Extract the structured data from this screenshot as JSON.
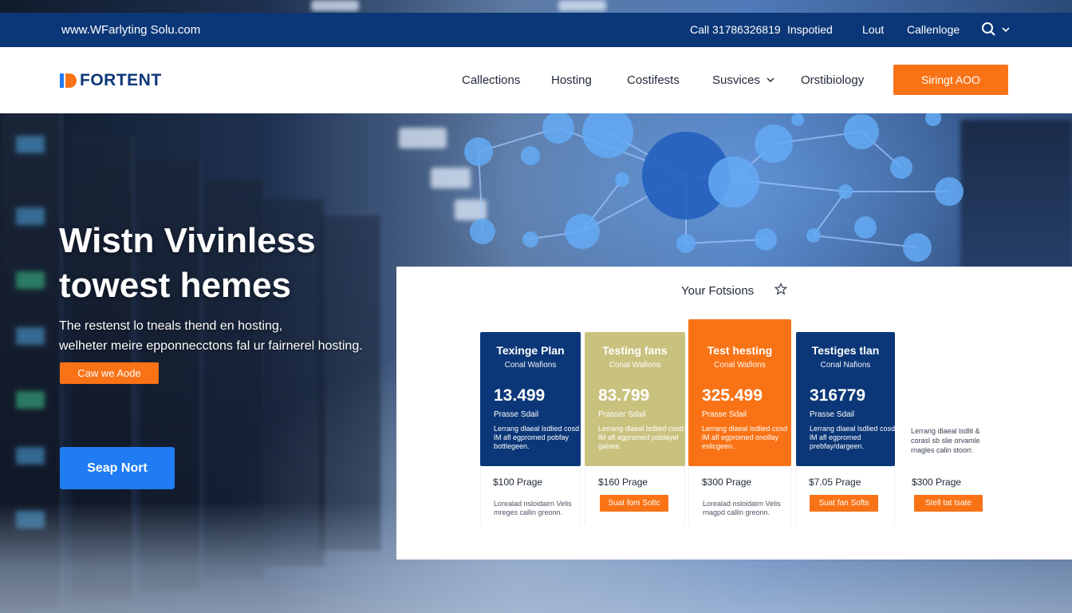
{
  "colors": {
    "topbar": "#0b3778",
    "accent_orange": "#f97316",
    "hero_blue_button": "#1f7cf2",
    "plan_navy": "#0b3778",
    "plan_khaki": "#c9c27f",
    "plan_orange": "#f97316"
  },
  "topbar": {
    "site": "www.WFarlyting Solu.com",
    "call": "Call 31786326819",
    "links": [
      "Inspotied",
      "Lout",
      "Callenloge"
    ],
    "search_icon": "search-icon",
    "dropdown_icon": "chevron-down-icon"
  },
  "navbar": {
    "logo_text": "FORTENT",
    "links": [
      "Callections",
      "Hosting",
      "Costifests",
      "Susvices",
      "Orstibiology"
    ],
    "services_icon": "chevron-down-icon",
    "cta": "Siringt AOO"
  },
  "hero": {
    "title_line1": "Wistn Vivinless",
    "title_line2": "towest hemes",
    "sub_line1": "The restenst lo tneals thend en hosting,",
    "sub_line2": "welheter meire epponnecctons fal ur fairnerel hosting.",
    "button1": "Caw we Aode",
    "button2": "Seap Nort"
  },
  "pricing": {
    "title": "Your Fotsions",
    "star_icon": "star-icon",
    "plans": [
      {
        "name": "Texinge Plan",
        "sub": "Conal Wafions",
        "price": "13.499",
        "tag": "Prasse Sdail",
        "desc": "Lerrang dlaeal lsdlied cosd lM afl egpromed pobfay bottlegeen.",
        "below_price": "$100 Prage",
        "below_desc": "Lorealad nsloidairn Velis mreges callin greonn."
      },
      {
        "name": "Testing fans",
        "sub": "Conal Wafions",
        "price": "83.799",
        "tag": "Prasser Sdail",
        "desc": "Lerrang dlaeal lsdlied cosd lM afl egpromed poblayel galsee.",
        "below_price": "$160 Prage",
        "below_button": "Suat fom Soltc"
      },
      {
        "name": "Test hesting",
        "sub": "Conal Wafions",
        "price": "325.499",
        "tag": "Prasse Sdail",
        "desc": "Lerrang dlaeal lsdlied cosd lM afl egpromed onolfay eslicgeen.",
        "below_price": "$300 Prage",
        "below_desc": "Lorealad nsloidairn Velis rnagpd callin greonn."
      },
      {
        "name": "Testiges tlan",
        "sub": "Conal Nafions",
        "price": "316779",
        "tag": "Prasse Sdail",
        "desc": "Lerrang dlaeal lsdlied cosd lM afl egpromed prebfay/dargeen.",
        "below_price": "$7.05 Prage",
        "below_button": "Suat fan Softs"
      }
    ],
    "extra": {
      "desc": "Lerrang dlaeal lsdlit & corasl sb slie orvamle rnagles calin stoorr.",
      "price": "$300 Prage",
      "button": "Stell tat tsate"
    }
  }
}
